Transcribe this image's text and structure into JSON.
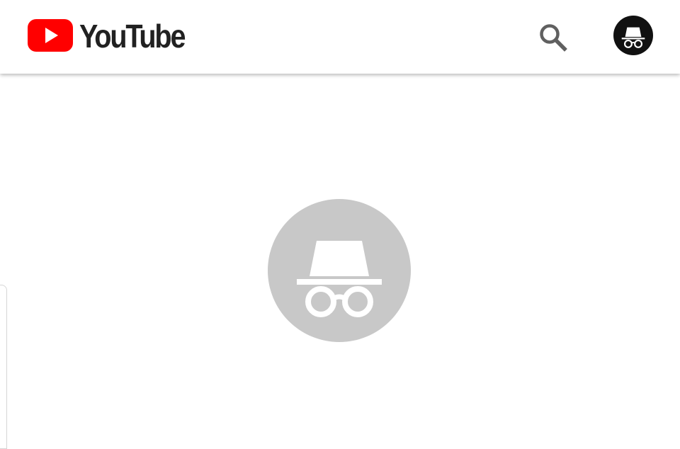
{
  "header": {
    "logo_text": "YouTube",
    "logo_icon": "youtube-play-icon",
    "search_icon": "search-icon",
    "account_icon": "incognito-icon"
  },
  "main": {
    "avatar_icon": "incognito-icon"
  },
  "colors": {
    "brand_red": "#FF0000",
    "text_dark": "#212121",
    "icon_gray": "#606060",
    "avatar_gray": "#C8C8C8",
    "account_bg": "#111111"
  }
}
